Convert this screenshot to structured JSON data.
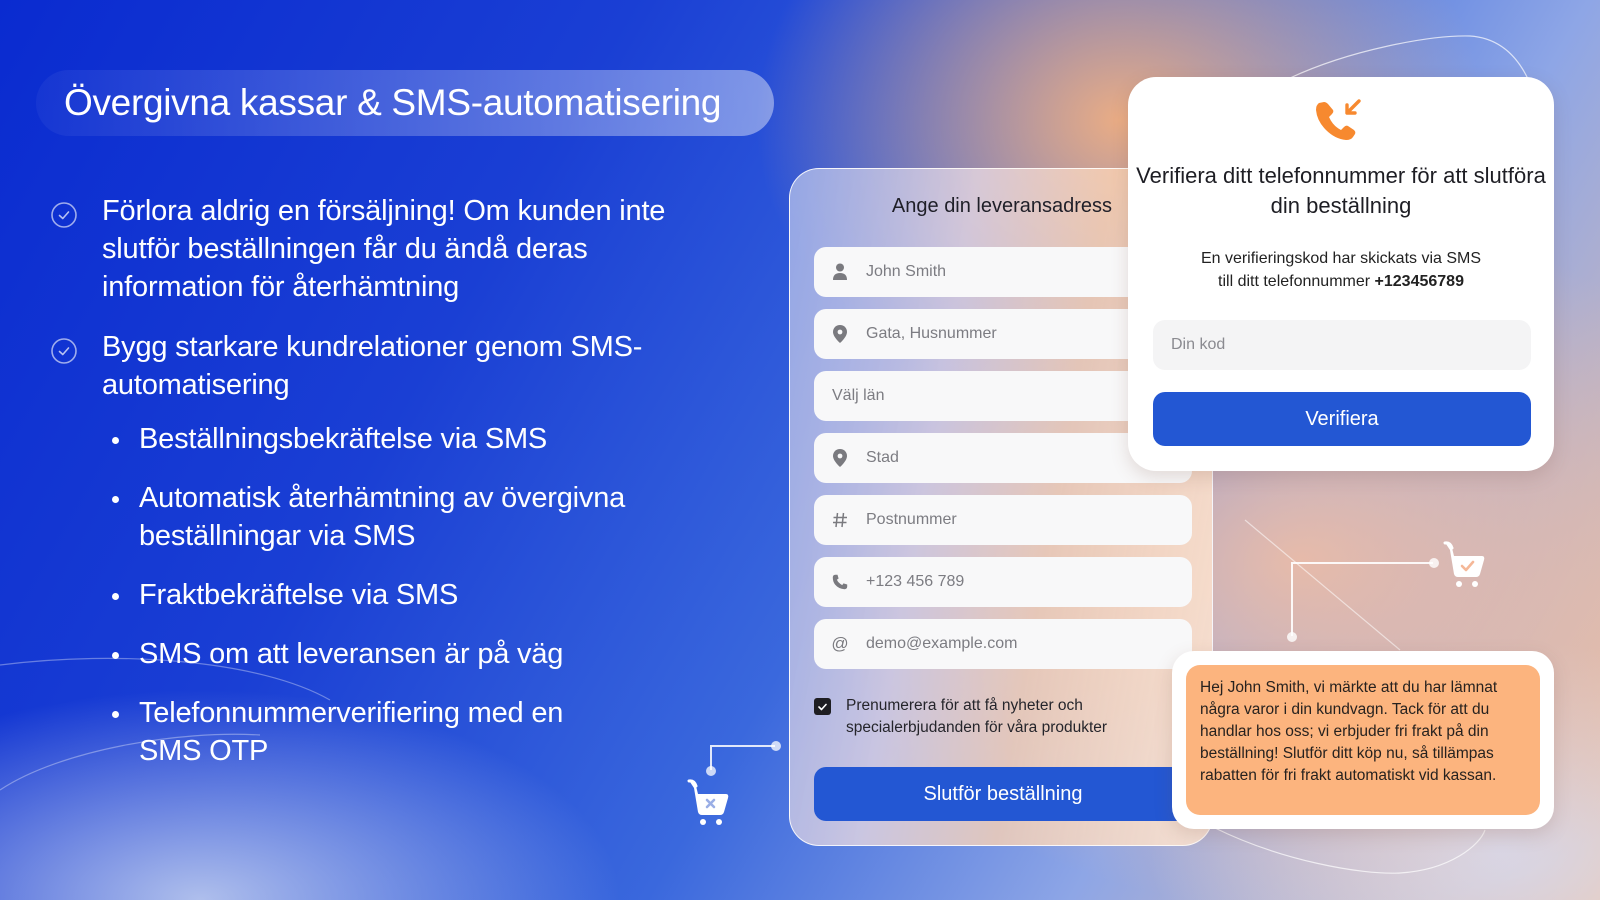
{
  "slide": {
    "title": "Övergivna kassar & SMS-automatisering",
    "colors": {
      "primary_blue": "#2357d3",
      "accent_orange": "#f7892f",
      "sms_bubble": "#fcb47e",
      "background_start": "#0a2bd0",
      "background_end": "#f2c2a0"
    }
  },
  "bullets": {
    "main": [
      {
        "icon": "check-circle-icon",
        "text": "Förlora aldrig en försäljning! Om kunden inte slutför beställningen får du ändå deras information för återhämtning"
      },
      {
        "icon": "check-circle-icon",
        "text": "Bygg starkare kundrelationer genom SMS-automatisering"
      }
    ],
    "sub": [
      "Beställningsbekräftelse via SMS",
      "Automatisk återhämtning av övergivna beställningar via SMS",
      "Fraktbekräftelse via SMS",
      "SMS om att leveransen är på väg",
      "Telefonnummerverifiering med en SMS OTP"
    ]
  },
  "address_form": {
    "title": "Ange din leveransadress",
    "fields": [
      {
        "icon": "person-icon",
        "value": "John Smith"
      },
      {
        "icon": "location-pin-icon",
        "value": "Gata, Husnummer"
      },
      {
        "icon": "",
        "value": "Välj län"
      },
      {
        "icon": "location-pin-icon",
        "value": "Stad"
      },
      {
        "icon": "hash-icon",
        "value": "Postnummer"
      },
      {
        "icon": "phone-icon",
        "value": "+123 456 789"
      },
      {
        "icon": "at-icon",
        "value": "demo@example.com"
      }
    ],
    "subscribe": {
      "checked": true,
      "label": "Prenumerera för att få nyheter och specialerbjudanden för våra produkter"
    },
    "submit_label": "Slutför beställning"
  },
  "verify_dialog": {
    "icon": "incoming-call-icon",
    "title": "Verifiera ditt telefonnummer för att slutföra din beställning",
    "subtitle_line1": "En verifieringskod har skickats via SMS",
    "subtitle_line2": "till ditt telefonnummer",
    "phone_number": "+123456789",
    "code_placeholder": "Din kod",
    "code_value": "",
    "verify_label": "Verifiera"
  },
  "sms_message": {
    "text": "Hej John Smith, vi märkte att du har lämnat några varor i din kundvagn. Tack för att du handlar hos oss; vi erbjuder fri frakt på din beställning! Slutför ditt köp nu, så tillämpas rabatten för fri frakt automatiskt vid kassan."
  },
  "decorations": {
    "cart_abandoned_icon": "cart-x-icon",
    "cart_completed_icon": "cart-check-icon"
  }
}
